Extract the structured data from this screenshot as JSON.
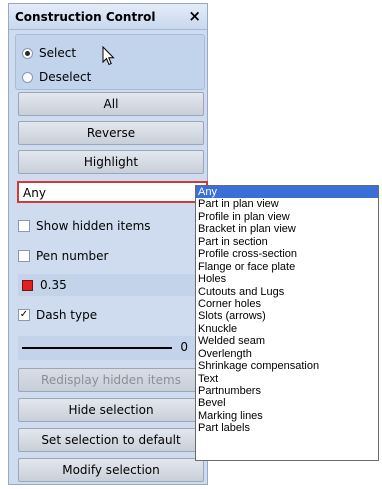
{
  "window": {
    "title": "Construction Control",
    "close_glyph": "×"
  },
  "mode": {
    "select_label": "Select",
    "deselect_label": "Deselect",
    "selected": "Select"
  },
  "buttons": {
    "all": "All",
    "reverse": "Reverse",
    "highlight": "Highlight",
    "redisplay": "Redisplay hidden items",
    "hide_selection": "Hide selection",
    "set_default": "Set selection to default",
    "modify": "Modify selection"
  },
  "filter": {
    "value": "Any",
    "options": [
      "Any",
      "Part in plan view",
      "Profile in plan view",
      "Bracket in plan view",
      "Part in section",
      "Profile cross-section",
      "Flange or face plate",
      "Holes",
      "Cutouts and Lugs",
      "Corner holes",
      "Slots (arrows)",
      "Knuckle",
      "Welded seam",
      "Overlength",
      "Shrinkage compensation",
      "Text",
      "Partnumbers",
      "Bevel",
      "Marking lines",
      "Part labels"
    ]
  },
  "options": {
    "show_hidden": {
      "label": "Show hidden items",
      "checked": false
    },
    "pen_number": {
      "label": "Pen number",
      "checked": false
    },
    "pen_color": "#e0201e",
    "pen_width": "0.35",
    "dash_type": {
      "label": "Dash type",
      "checked": true
    },
    "dash_value": "0"
  }
}
